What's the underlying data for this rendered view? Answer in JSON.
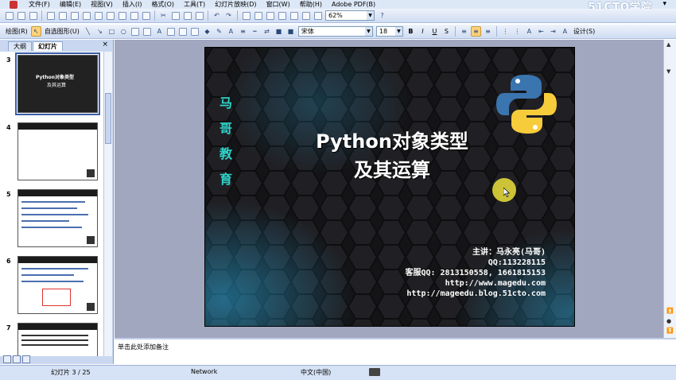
{
  "menu": {
    "items": [
      "文件(F)",
      "编辑(E)",
      "视图(V)",
      "插入(I)",
      "格式(O)",
      "工具(T)",
      "幻灯片放映(D)",
      "窗口(W)",
      "帮助(H)",
      "Adobe PDF(B)"
    ],
    "watermark": "51CTO学院"
  },
  "toolbar1": {
    "zoom": "62%"
  },
  "toolbar2": {
    "draw_label": "绘图(R)",
    "autoshape_label": "自选图形(U)",
    "font_name": "宋体",
    "font_size": "18",
    "design_label": "设计(S)"
  },
  "leftpanel": {
    "tabs": [
      "大纲",
      "幻灯片"
    ],
    "close": "×",
    "slide_numbers": [
      "3",
      "4",
      "5",
      "6",
      "7"
    ],
    "thumb3_title": "Python对象类型",
    "thumb3_sub": "及其运算"
  },
  "slide": {
    "vertical_text": [
      "马",
      "哥",
      "教",
      "育"
    ],
    "title_line1": "Python对象类型",
    "title_line2": "及其运算",
    "info": [
      "主讲：马永亮(马哥)",
      "QQ:113228115",
      "客服QQ: 2813150558, 1661815153",
      "http://www.magedu.com",
      "http://mageedu.blog.51cto.com"
    ],
    "colors": {
      "accent": "#2ed3c9",
      "background": "#1a1a1c",
      "hex_glow": "#2aa7d9"
    }
  },
  "notes": {
    "placeholder": "单击此处添加备注"
  },
  "status": {
    "slide_position": "幻灯片 3 / 25",
    "template": "Network",
    "language": "中文(中国)"
  }
}
